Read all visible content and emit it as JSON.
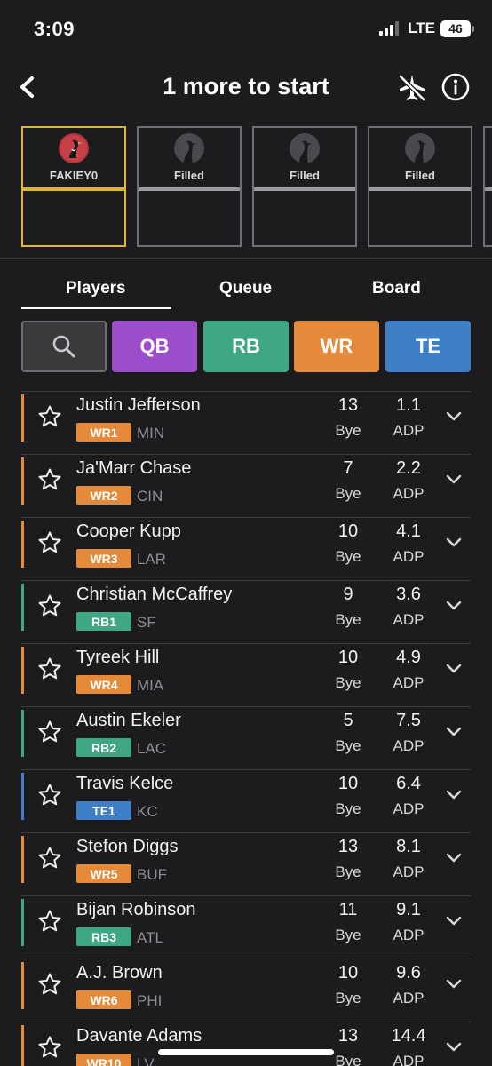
{
  "status": {
    "time": "3:09",
    "network": "LTE",
    "battery": "46"
  },
  "header": {
    "title": "1 more to start",
    "back_icon": "chevron-left-icon",
    "plane_icon": "airplane-off-icon",
    "info_icon": "info-icon"
  },
  "slots": [
    {
      "label": "FAKIEY0",
      "state": "user"
    },
    {
      "label": "Filled",
      "state": "filled"
    },
    {
      "label": "Filled",
      "state": "filled"
    },
    {
      "label": "Filled",
      "state": "filled"
    }
  ],
  "tabs": {
    "players": "Players",
    "queue": "Queue",
    "board": "Board",
    "active": "players"
  },
  "filters": {
    "qb": "QB",
    "rb": "RB",
    "wr": "WR",
    "te": "TE",
    "search_icon": "search-icon"
  },
  "colors": {
    "QB": "#9b4dca",
    "RB": "#3fa784",
    "WR": "#e58a3a",
    "TE": "#3f7fc7",
    "accent": "#e0b43a"
  },
  "labels": {
    "bye": "Bye",
    "adp": "ADP"
  },
  "players": [
    {
      "name": "Justin Jefferson",
      "rank": "WR1",
      "pos": "WR",
      "team": "MIN",
      "bye": "13",
      "adp": "1.1"
    },
    {
      "name": "Ja'Marr Chase",
      "rank": "WR2",
      "pos": "WR",
      "team": "CIN",
      "bye": "7",
      "adp": "2.2"
    },
    {
      "name": "Cooper Kupp",
      "rank": "WR3",
      "pos": "WR",
      "team": "LAR",
      "bye": "10",
      "adp": "4.1"
    },
    {
      "name": "Christian McCaffrey",
      "rank": "RB1",
      "pos": "RB",
      "team": "SF",
      "bye": "9",
      "adp": "3.6"
    },
    {
      "name": "Tyreek Hill",
      "rank": "WR4",
      "pos": "WR",
      "team": "MIA",
      "bye": "10",
      "adp": "4.9"
    },
    {
      "name": "Austin Ekeler",
      "rank": "RB2",
      "pos": "RB",
      "team": "LAC",
      "bye": "5",
      "adp": "7.5"
    },
    {
      "name": "Travis Kelce",
      "rank": "TE1",
      "pos": "TE",
      "team": "KC",
      "bye": "10",
      "adp": "6.4"
    },
    {
      "name": "Stefon Diggs",
      "rank": "WR5",
      "pos": "WR",
      "team": "BUF",
      "bye": "13",
      "adp": "8.1"
    },
    {
      "name": "Bijan Robinson",
      "rank": "RB3",
      "pos": "RB",
      "team": "ATL",
      "bye": "11",
      "adp": "9.1"
    },
    {
      "name": "A.J. Brown",
      "rank": "WR6",
      "pos": "WR",
      "team": "PHI",
      "bye": "10",
      "adp": "9.6"
    },
    {
      "name": "Davante Adams",
      "rank": "WR10",
      "pos": "WR",
      "team": "LV",
      "bye": "13",
      "adp": "14.4"
    }
  ]
}
